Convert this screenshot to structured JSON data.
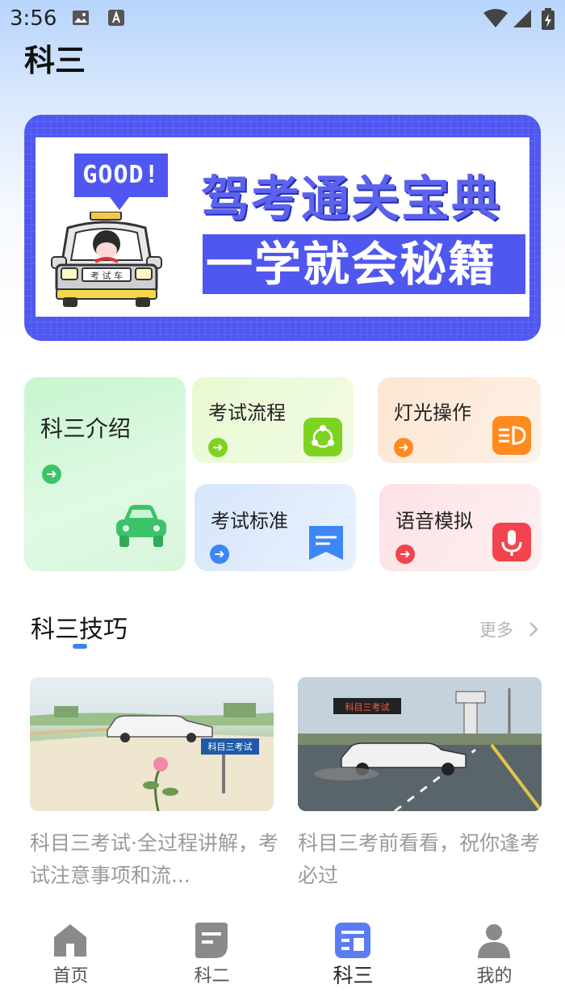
{
  "status_bar": {
    "time": "3:56"
  },
  "header": {
    "title": "科三"
  },
  "banner": {
    "badge": "GOOD!",
    "line1": "驾考通关宝典",
    "line2": "一学就会秘籍",
    "car_plate": "考 试 车"
  },
  "features": [
    {
      "title": "科三介绍",
      "accent": "#3cc36a"
    },
    {
      "title": "考试流程",
      "accent": "#7ed321"
    },
    {
      "title": "灯光操作",
      "accent": "#ff8a1e"
    },
    {
      "title": "考试标准",
      "accent": "#3d86f5"
    },
    {
      "title": "语音模拟",
      "accent": "#f2444f"
    }
  ],
  "section": {
    "title": "科三技巧",
    "more": "更多"
  },
  "articles": [
    {
      "desc": "科目三考试·全过程讲解，考试注意事项和流...",
      "sign": "科目三考试"
    },
    {
      "desc": "科目三考前看看，祝你逢考必过",
      "sign": "科目三考试"
    }
  ],
  "bottom_nav": [
    {
      "label": "首页"
    },
    {
      "label": "科二"
    },
    {
      "label": "科三"
    },
    {
      "label": "我的"
    }
  ]
}
